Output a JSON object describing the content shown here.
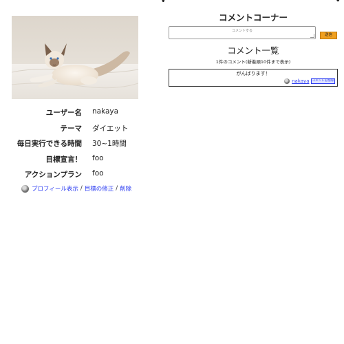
{
  "top_cut": {
    "left_text": "y",
    "right_text": "v"
  },
  "profile": {
    "rows": [
      {
        "key": "ユーザー名",
        "value": "nakaya"
      },
      {
        "key": "テーマ",
        "value": "ダイエット"
      },
      {
        "key": "毎日実行できる時間",
        "value": "30~1時間"
      },
      {
        "key": "目標宣言！",
        "value": "foo"
      },
      {
        "key": "アクションプラン",
        "value": "foo"
      }
    ],
    "links": {
      "profile": "プロフィール表示",
      "edit": "目標の修正",
      "delete": "削除",
      "separator": "/"
    }
  },
  "comments": {
    "corner_title": "コメントコーナー",
    "input_placeholder": "コメントする",
    "send_label": "送信",
    "list_title": "コメント一覧",
    "count_note": "1件のコメント(新着順10件まで表示)",
    "items": [
      {
        "text": "がんばります！",
        "user": "nakaya",
        "delete_label": "コメントを削除"
      }
    ]
  },
  "colors": {
    "link": "#2b3cf2",
    "send_button": "#f0a020"
  }
}
